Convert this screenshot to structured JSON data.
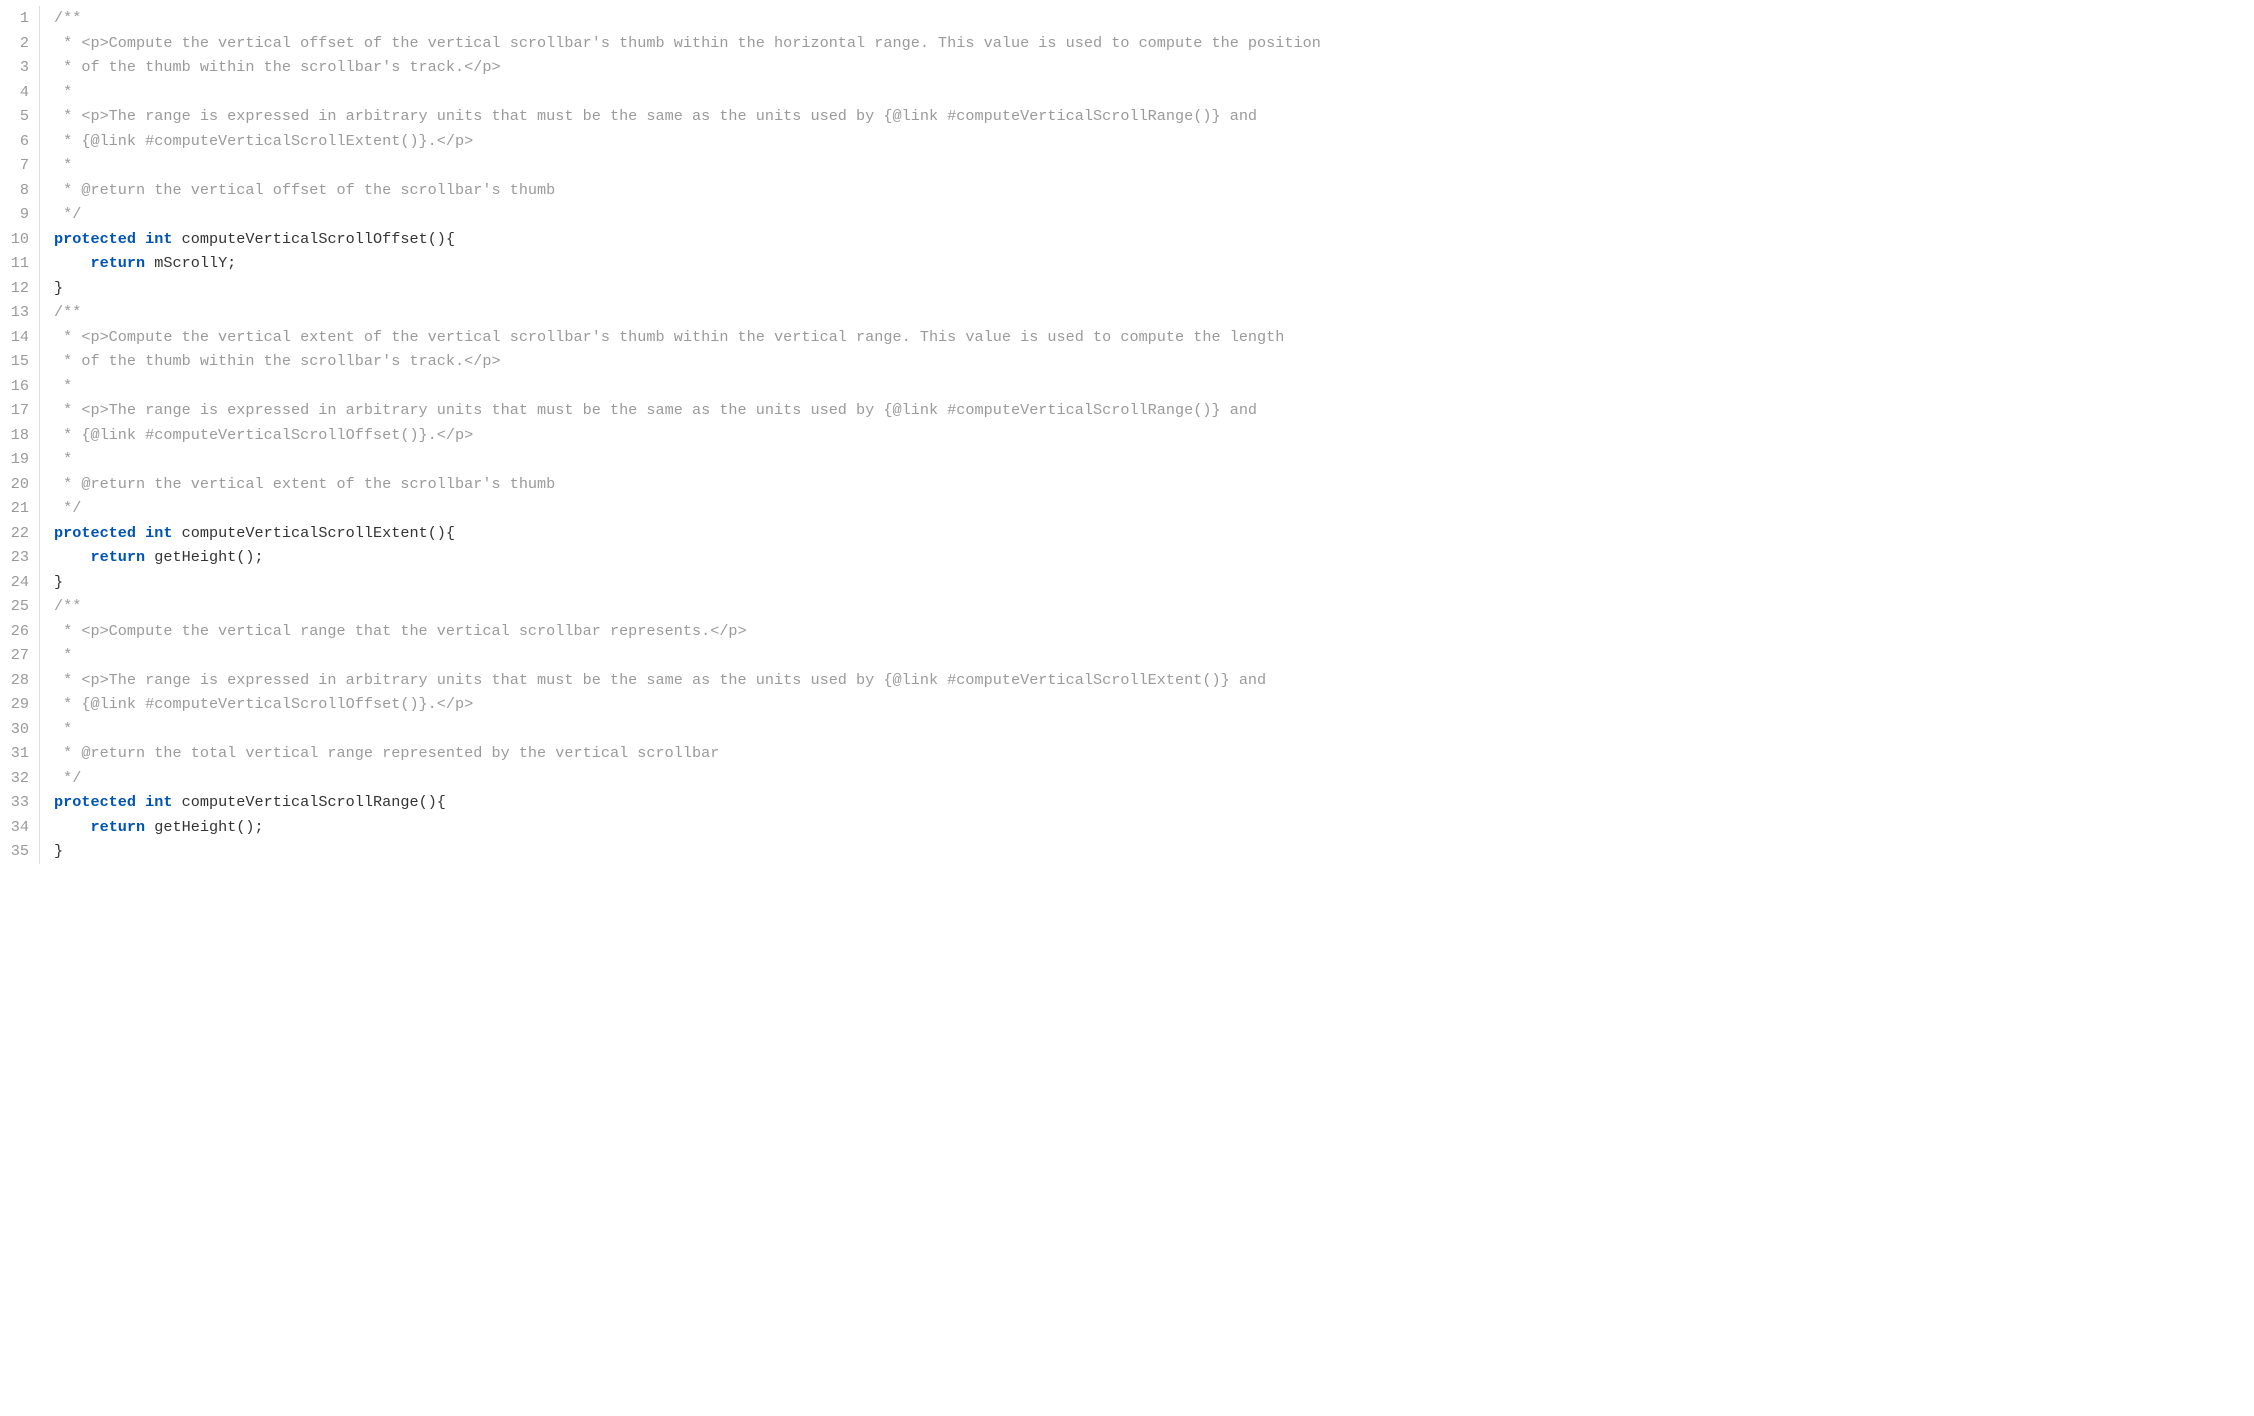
{
  "editor": {
    "lineNumbers": [
      "1",
      "2",
      "3",
      "4",
      "5",
      "6",
      "7",
      "8",
      "9",
      "10",
      "11",
      "12",
      "13",
      "14",
      "15",
      "16",
      "17",
      "18",
      "19",
      "20",
      "21",
      "22",
      "23",
      "24",
      "25",
      "26",
      "27",
      "28",
      "29",
      "30",
      "31",
      "32",
      "33",
      "34",
      "35"
    ],
    "lines": [
      [
        {
          "c": "comment",
          "t": "/**"
        }
      ],
      [
        {
          "c": "comment",
          "t": " * <p>Compute the vertical offset of the vertical scrollbar's thumb within the horizontal range. This value is used to compute the position"
        }
      ],
      [
        {
          "c": "comment",
          "t": " * of the thumb within the scrollbar's track.</p>"
        }
      ],
      [
        {
          "c": "comment",
          "t": " *"
        }
      ],
      [
        {
          "c": "comment",
          "t": " * <p>The range is expressed in arbitrary units that must be the same as the units used by {@link #computeVerticalScrollRange()} and"
        }
      ],
      [
        {
          "c": "comment",
          "t": " * {@link #computeVerticalScrollExtent()}.</p>"
        }
      ],
      [
        {
          "c": "comment",
          "t": " *"
        }
      ],
      [
        {
          "c": "comment",
          "t": " * @return the vertical offset of the scrollbar's thumb"
        }
      ],
      [
        {
          "c": "comment",
          "t": " */"
        }
      ],
      [
        {
          "c": "keyword",
          "t": "protected"
        },
        {
          "c": "default",
          "t": " "
        },
        {
          "c": "keyword",
          "t": "int"
        },
        {
          "c": "default",
          "t": " computeVerticalScrollOffset(){"
        }
      ],
      [
        {
          "c": "default",
          "t": "    "
        },
        {
          "c": "keyword",
          "t": "return"
        },
        {
          "c": "default",
          "t": " mScrollY;"
        }
      ],
      [
        {
          "c": "default",
          "t": "}"
        }
      ],
      [
        {
          "c": "comment",
          "t": "/**"
        }
      ],
      [
        {
          "c": "comment",
          "t": " * <p>Compute the vertical extent of the vertical scrollbar's thumb within the vertical range. This value is used to compute the length"
        }
      ],
      [
        {
          "c": "comment",
          "t": " * of the thumb within the scrollbar's track.</p>"
        }
      ],
      [
        {
          "c": "comment",
          "t": " *"
        }
      ],
      [
        {
          "c": "comment",
          "t": " * <p>The range is expressed in arbitrary units that must be the same as the units used by {@link #computeVerticalScrollRange()} and"
        }
      ],
      [
        {
          "c": "comment",
          "t": " * {@link #computeVerticalScrollOffset()}.</p>"
        }
      ],
      [
        {
          "c": "comment",
          "t": " *"
        }
      ],
      [
        {
          "c": "comment",
          "t": " * @return the vertical extent of the scrollbar's thumb"
        }
      ],
      [
        {
          "c": "comment",
          "t": " */"
        }
      ],
      [
        {
          "c": "keyword",
          "t": "protected"
        },
        {
          "c": "default",
          "t": " "
        },
        {
          "c": "keyword",
          "t": "int"
        },
        {
          "c": "default",
          "t": " computeVerticalScrollExtent(){"
        }
      ],
      [
        {
          "c": "default",
          "t": "    "
        },
        {
          "c": "keyword",
          "t": "return"
        },
        {
          "c": "default",
          "t": " getHeight();"
        }
      ],
      [
        {
          "c": "default",
          "t": "}"
        }
      ],
      [
        {
          "c": "comment",
          "t": "/**"
        }
      ],
      [
        {
          "c": "comment",
          "t": " * <p>Compute the vertical range that the vertical scrollbar represents.</p>"
        }
      ],
      [
        {
          "c": "comment",
          "t": " *"
        }
      ],
      [
        {
          "c": "comment",
          "t": " * <p>The range is expressed in arbitrary units that must be the same as the units used by {@link #computeVerticalScrollExtent()} and"
        }
      ],
      [
        {
          "c": "comment",
          "t": " * {@link #computeVerticalScrollOffset()}.</p>"
        }
      ],
      [
        {
          "c": "comment",
          "t": " *"
        }
      ],
      [
        {
          "c": "comment",
          "t": " * @return the total vertical range represented by the vertical scrollbar"
        }
      ],
      [
        {
          "c": "comment",
          "t": " */"
        }
      ],
      [
        {
          "c": "keyword",
          "t": "protected"
        },
        {
          "c": "default",
          "t": " "
        },
        {
          "c": "keyword",
          "t": "int"
        },
        {
          "c": "default",
          "t": " computeVerticalScrollRange(){"
        }
      ],
      [
        {
          "c": "default",
          "t": "    "
        },
        {
          "c": "keyword",
          "t": "return"
        },
        {
          "c": "default",
          "t": " getHeight();"
        }
      ],
      [
        {
          "c": "default",
          "t": "}"
        }
      ]
    ]
  }
}
